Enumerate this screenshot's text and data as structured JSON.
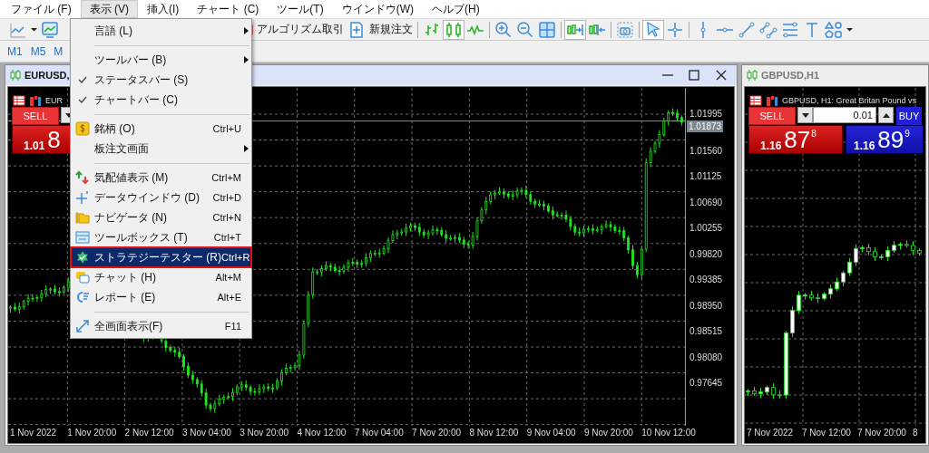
{
  "menubar": [
    {
      "label": "ファイル (F)",
      "selected": false
    },
    {
      "label": "表示 (V)",
      "selected": true
    },
    {
      "label": "挿入(I)",
      "selected": false
    },
    {
      "label": "チャート (C)",
      "selected": false
    },
    {
      "label": "ツール(T)",
      "selected": false
    },
    {
      "label": "ウインドウ(W)",
      "selected": false
    },
    {
      "label": "ヘルプ(H)",
      "selected": false
    }
  ],
  "toolbar_left": [
    {
      "kind": "menu_button",
      "selected": false
    },
    {
      "kind": "button",
      "selected": false
    }
  ],
  "toolbar_right": [
    {
      "kind": "labeled",
      "label": "アルゴリズム取引",
      "selected": false
    },
    {
      "kind": "labeled",
      "label": "新規注文",
      "selected": false
    },
    {
      "kind": "separator"
    },
    {
      "kind": "button",
      "selected": false
    },
    {
      "kind": "button",
      "selected": true
    },
    {
      "kind": "button",
      "selected": false
    },
    {
      "kind": "separator"
    },
    {
      "kind": "button",
      "selected": false
    },
    {
      "kind": "button",
      "selected": false
    },
    {
      "kind": "button",
      "selected": false
    },
    {
      "kind": "separator"
    },
    {
      "kind": "button",
      "selected": true
    },
    {
      "kind": "button",
      "selected": false
    },
    {
      "kind": "separator"
    },
    {
      "kind": "button",
      "selected": false
    },
    {
      "kind": "separator"
    },
    {
      "kind": "button",
      "selected": true
    },
    {
      "kind": "button",
      "selected": false
    },
    {
      "kind": "separator"
    },
    {
      "kind": "button",
      "selected": false
    },
    {
      "kind": "button",
      "selected": false
    },
    {
      "kind": "button",
      "selected": false
    },
    {
      "kind": "button",
      "selected": false
    },
    {
      "kind": "button",
      "selected": false
    },
    {
      "kind": "button",
      "selected": false
    },
    {
      "kind": "menu_button",
      "selected": false
    }
  ],
  "timeframes": [
    "M1",
    "M5",
    "M"
  ],
  "view_menu": {
    "items": [
      {
        "kind": "item",
        "label": "言語 (L)",
        "submenu": true,
        "checked": false,
        "selected": false
      },
      {
        "kind": "separator"
      },
      {
        "kind": "item",
        "label": "ツールバー (B)",
        "submenu": true,
        "checked": false,
        "selected": false
      },
      {
        "kind": "item",
        "label": "ステータスバー (S)",
        "submenu": false,
        "checked": true,
        "selected": false
      },
      {
        "kind": "item",
        "label": "チャートバー (C)",
        "submenu": false,
        "checked": true,
        "selected": false
      },
      {
        "kind": "separator"
      },
      {
        "kind": "item",
        "label": "銘柄 (O)",
        "shortcut": "Ctrl+U",
        "submenu": false,
        "checked": false,
        "selected": false
      },
      {
        "kind": "item",
        "label": "板注文画面",
        "submenu": true,
        "checked": false,
        "selected": false
      },
      {
        "kind": "separator"
      },
      {
        "kind": "item",
        "label": "気配値表示 (M)",
        "shortcut": "Ctrl+M",
        "submenu": false,
        "checked": false,
        "selected": false
      },
      {
        "kind": "item",
        "label": "データウインドウ (D)",
        "shortcut": "Ctrl+D",
        "submenu": false,
        "checked": false,
        "selected": false
      },
      {
        "kind": "item",
        "label": "ナビゲータ (N)",
        "shortcut": "Ctrl+N",
        "submenu": false,
        "checked": false,
        "selected": false
      },
      {
        "kind": "item",
        "label": "ツールボックス (T)",
        "shortcut": "Ctrl+T",
        "submenu": false,
        "checked": false,
        "selected": false
      },
      {
        "kind": "item",
        "label": "ストラテジーテスター (R)",
        "shortcut": "Ctrl+R",
        "submenu": false,
        "checked": false,
        "selected": true
      },
      {
        "kind": "item",
        "label": "チャット (H)",
        "shortcut": "Alt+M",
        "submenu": false,
        "checked": false,
        "selected": false
      },
      {
        "kind": "item",
        "label": "レポート (E)",
        "shortcut": "Alt+E",
        "submenu": false,
        "checked": false,
        "selected": false
      },
      {
        "kind": "separator"
      },
      {
        "kind": "item",
        "label": "全画面表示(F)",
        "shortcut": "F11",
        "submenu": false,
        "checked": false,
        "selected": false
      }
    ]
  },
  "charts": [
    {
      "title": "EURUSD,",
      "active": true,
      "header": "EUR",
      "sell": "SELL",
      "sell_price": {
        "prefix": "1.01",
        "big": "8"
      },
      "price_labels": [
        "1.01995",
        "1.01560",
        "1.01125",
        "1.00690",
        "1.00255",
        "0.99820",
        "0.99385",
        "0.98950",
        "0.98515",
        "0.98080",
        "0.97645"
      ],
      "current_price": "1.01873",
      "time_labels": [
        "1 Nov 2022",
        "1 Nov 20:00",
        "2 Nov 12:00",
        "3 Nov 04:00",
        "3 Nov 20:00",
        "4 Nov 12:00",
        "7 Nov 04:00",
        "7 Nov 20:00",
        "8 Nov 12:00",
        "9 Nov 04:00",
        "9 Nov 20:00",
        "10 Nov 12:00"
      ]
    },
    {
      "title": "GBPUSD,H1",
      "active": false,
      "header": "GBPUSD, H1:  Great Britan Pound vs",
      "sell": "SELL",
      "lot": "0.01",
      "buy": "BUY",
      "sell_price": {
        "prefix": "1.16",
        "big": "87",
        "sup": "8"
      },
      "buy_price": {
        "prefix": "1.16",
        "big": "89",
        "sup": "9"
      },
      "time_labels": [
        "7 Nov 2022",
        "7 Nov 12:00",
        "7 Nov 20:00",
        "8"
      ]
    }
  ]
}
